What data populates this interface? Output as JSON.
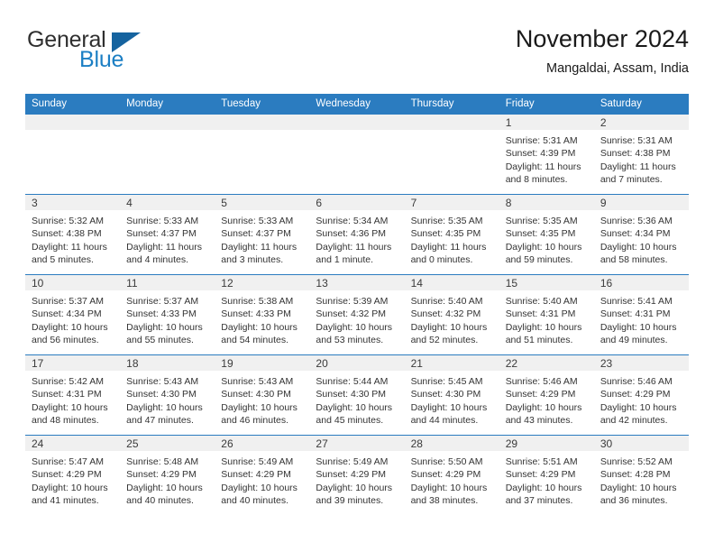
{
  "brand": {
    "name_part1": "General",
    "name_part2": "Blue",
    "triangle_color": "#15639f"
  },
  "header": {
    "title": "November 2024",
    "subtitle": "Mangaldai, Assam, India"
  },
  "theme": {
    "header_blue": "#2b7cc0",
    "daynum_strip": "#f0f0f0",
    "text": "#333333"
  },
  "weekdays": [
    "Sunday",
    "Monday",
    "Tuesday",
    "Wednesday",
    "Thursday",
    "Friday",
    "Saturday"
  ],
  "weeks": [
    [
      {
        "day": "",
        "sunrise": "",
        "sunset": "",
        "daylight": "",
        "daylight2": "",
        "empty": true
      },
      {
        "day": "",
        "sunrise": "",
        "sunset": "",
        "daylight": "",
        "daylight2": "",
        "empty": true
      },
      {
        "day": "",
        "sunrise": "",
        "sunset": "",
        "daylight": "",
        "daylight2": "",
        "empty": true
      },
      {
        "day": "",
        "sunrise": "",
        "sunset": "",
        "daylight": "",
        "daylight2": "",
        "empty": true
      },
      {
        "day": "",
        "sunrise": "",
        "sunset": "",
        "daylight": "",
        "daylight2": "",
        "empty": true
      },
      {
        "day": "1",
        "sunrise": "Sunrise: 5:31 AM",
        "sunset": "Sunset: 4:39 PM",
        "daylight": "Daylight: 11 hours",
        "daylight2": "and 8 minutes.",
        "empty": false
      },
      {
        "day": "2",
        "sunrise": "Sunrise: 5:31 AM",
        "sunset": "Sunset: 4:38 PM",
        "daylight": "Daylight: 11 hours",
        "daylight2": "and 7 minutes.",
        "empty": false
      }
    ],
    [
      {
        "day": "3",
        "sunrise": "Sunrise: 5:32 AM",
        "sunset": "Sunset: 4:38 PM",
        "daylight": "Daylight: 11 hours",
        "daylight2": "and 5 minutes.",
        "empty": false
      },
      {
        "day": "4",
        "sunrise": "Sunrise: 5:33 AM",
        "sunset": "Sunset: 4:37 PM",
        "daylight": "Daylight: 11 hours",
        "daylight2": "and 4 minutes.",
        "empty": false
      },
      {
        "day": "5",
        "sunrise": "Sunrise: 5:33 AM",
        "sunset": "Sunset: 4:37 PM",
        "daylight": "Daylight: 11 hours",
        "daylight2": "and 3 minutes.",
        "empty": false
      },
      {
        "day": "6",
        "sunrise": "Sunrise: 5:34 AM",
        "sunset": "Sunset: 4:36 PM",
        "daylight": "Daylight: 11 hours",
        "daylight2": "and 1 minute.",
        "empty": false
      },
      {
        "day": "7",
        "sunrise": "Sunrise: 5:35 AM",
        "sunset": "Sunset: 4:35 PM",
        "daylight": "Daylight: 11 hours",
        "daylight2": "and 0 minutes.",
        "empty": false
      },
      {
        "day": "8",
        "sunrise": "Sunrise: 5:35 AM",
        "sunset": "Sunset: 4:35 PM",
        "daylight": "Daylight: 10 hours",
        "daylight2": "and 59 minutes.",
        "empty": false
      },
      {
        "day": "9",
        "sunrise": "Sunrise: 5:36 AM",
        "sunset": "Sunset: 4:34 PM",
        "daylight": "Daylight: 10 hours",
        "daylight2": "and 58 minutes.",
        "empty": false
      }
    ],
    [
      {
        "day": "10",
        "sunrise": "Sunrise: 5:37 AM",
        "sunset": "Sunset: 4:34 PM",
        "daylight": "Daylight: 10 hours",
        "daylight2": "and 56 minutes.",
        "empty": false
      },
      {
        "day": "11",
        "sunrise": "Sunrise: 5:37 AM",
        "sunset": "Sunset: 4:33 PM",
        "daylight": "Daylight: 10 hours",
        "daylight2": "and 55 minutes.",
        "empty": false
      },
      {
        "day": "12",
        "sunrise": "Sunrise: 5:38 AM",
        "sunset": "Sunset: 4:33 PM",
        "daylight": "Daylight: 10 hours",
        "daylight2": "and 54 minutes.",
        "empty": false
      },
      {
        "day": "13",
        "sunrise": "Sunrise: 5:39 AM",
        "sunset": "Sunset: 4:32 PM",
        "daylight": "Daylight: 10 hours",
        "daylight2": "and 53 minutes.",
        "empty": false
      },
      {
        "day": "14",
        "sunrise": "Sunrise: 5:40 AM",
        "sunset": "Sunset: 4:32 PM",
        "daylight": "Daylight: 10 hours",
        "daylight2": "and 52 minutes.",
        "empty": false
      },
      {
        "day": "15",
        "sunrise": "Sunrise: 5:40 AM",
        "sunset": "Sunset: 4:31 PM",
        "daylight": "Daylight: 10 hours",
        "daylight2": "and 51 minutes.",
        "empty": false
      },
      {
        "day": "16",
        "sunrise": "Sunrise: 5:41 AM",
        "sunset": "Sunset: 4:31 PM",
        "daylight": "Daylight: 10 hours",
        "daylight2": "and 49 minutes.",
        "empty": false
      }
    ],
    [
      {
        "day": "17",
        "sunrise": "Sunrise: 5:42 AM",
        "sunset": "Sunset: 4:31 PM",
        "daylight": "Daylight: 10 hours",
        "daylight2": "and 48 minutes.",
        "empty": false
      },
      {
        "day": "18",
        "sunrise": "Sunrise: 5:43 AM",
        "sunset": "Sunset: 4:30 PM",
        "daylight": "Daylight: 10 hours",
        "daylight2": "and 47 minutes.",
        "empty": false
      },
      {
        "day": "19",
        "sunrise": "Sunrise: 5:43 AM",
        "sunset": "Sunset: 4:30 PM",
        "daylight": "Daylight: 10 hours",
        "daylight2": "and 46 minutes.",
        "empty": false
      },
      {
        "day": "20",
        "sunrise": "Sunrise: 5:44 AM",
        "sunset": "Sunset: 4:30 PM",
        "daylight": "Daylight: 10 hours",
        "daylight2": "and 45 minutes.",
        "empty": false
      },
      {
        "day": "21",
        "sunrise": "Sunrise: 5:45 AM",
        "sunset": "Sunset: 4:30 PM",
        "daylight": "Daylight: 10 hours",
        "daylight2": "and 44 minutes.",
        "empty": false
      },
      {
        "day": "22",
        "sunrise": "Sunrise: 5:46 AM",
        "sunset": "Sunset: 4:29 PM",
        "daylight": "Daylight: 10 hours",
        "daylight2": "and 43 minutes.",
        "empty": false
      },
      {
        "day": "23",
        "sunrise": "Sunrise: 5:46 AM",
        "sunset": "Sunset: 4:29 PM",
        "daylight": "Daylight: 10 hours",
        "daylight2": "and 42 minutes.",
        "empty": false
      }
    ],
    [
      {
        "day": "24",
        "sunrise": "Sunrise: 5:47 AM",
        "sunset": "Sunset: 4:29 PM",
        "daylight": "Daylight: 10 hours",
        "daylight2": "and 41 minutes.",
        "empty": false
      },
      {
        "day": "25",
        "sunrise": "Sunrise: 5:48 AM",
        "sunset": "Sunset: 4:29 PM",
        "daylight": "Daylight: 10 hours",
        "daylight2": "and 40 minutes.",
        "empty": false
      },
      {
        "day": "26",
        "sunrise": "Sunrise: 5:49 AM",
        "sunset": "Sunset: 4:29 PM",
        "daylight": "Daylight: 10 hours",
        "daylight2": "and 40 minutes.",
        "empty": false
      },
      {
        "day": "27",
        "sunrise": "Sunrise: 5:49 AM",
        "sunset": "Sunset: 4:29 PM",
        "daylight": "Daylight: 10 hours",
        "daylight2": "and 39 minutes.",
        "empty": false
      },
      {
        "day": "28",
        "sunrise": "Sunrise: 5:50 AM",
        "sunset": "Sunset: 4:29 PM",
        "daylight": "Daylight: 10 hours",
        "daylight2": "and 38 minutes.",
        "empty": false
      },
      {
        "day": "29",
        "sunrise": "Sunrise: 5:51 AM",
        "sunset": "Sunset: 4:29 PM",
        "daylight": "Daylight: 10 hours",
        "daylight2": "and 37 minutes.",
        "empty": false
      },
      {
        "day": "30",
        "sunrise": "Sunrise: 5:52 AM",
        "sunset": "Sunset: 4:28 PM",
        "daylight": "Daylight: 10 hours",
        "daylight2": "and 36 minutes.",
        "empty": false
      }
    ]
  ]
}
